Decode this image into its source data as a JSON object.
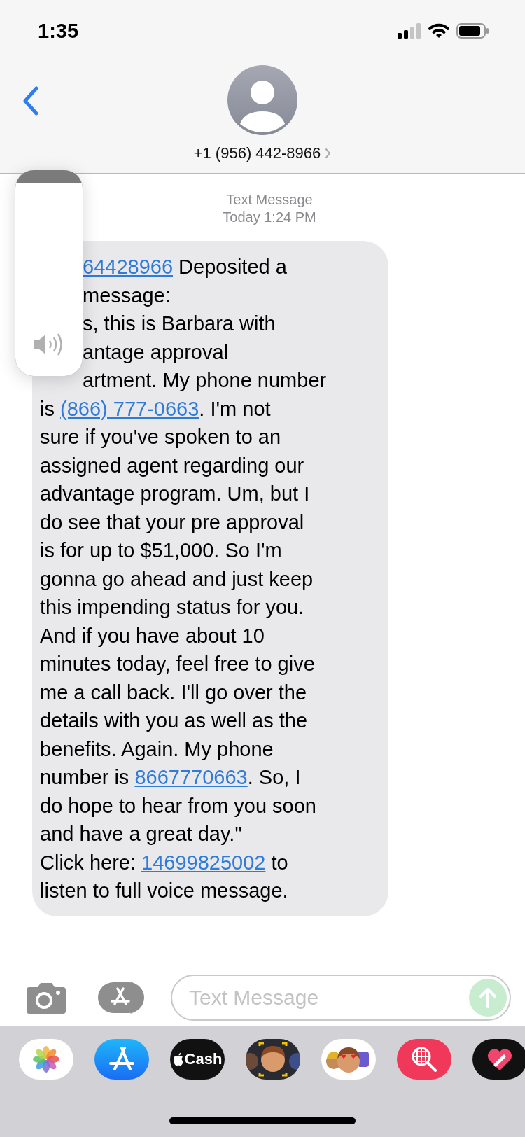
{
  "status_bar": {
    "time": "1:35"
  },
  "header": {
    "contact": "+1 (956) 442-8966"
  },
  "timestamp": {
    "service": "Text Message",
    "time": "Today 1:24 PM"
  },
  "message": {
    "lines": [
      {
        "covered": true,
        "parts": [
          {
            "kind": "link",
            "text": "64428966"
          },
          {
            "kind": "text",
            "text": " Deposited a"
          }
        ]
      },
      {
        "covered": true,
        "parts": [
          {
            "kind": "text",
            "text": "message:"
          }
        ]
      },
      {
        "covered": true,
        "parts": [
          {
            "kind": "text",
            "text": "s, this is Barbara with"
          }
        ]
      },
      {
        "covered": true,
        "parts": [
          {
            "kind": "text",
            "text": "antage approval"
          }
        ]
      },
      {
        "covered": true,
        "parts": [
          {
            "kind": "text",
            "text": "artment. My phone number"
          }
        ]
      },
      {
        "covered": false,
        "parts": [
          {
            "kind": "text",
            "text": "is "
          },
          {
            "kind": "link",
            "text": "(866) 777-0663"
          },
          {
            "kind": "text",
            "text": ". I'm not"
          }
        ]
      },
      {
        "covered": false,
        "parts": [
          {
            "kind": "text",
            "text": "sure if you've spoken to an"
          }
        ]
      },
      {
        "covered": false,
        "parts": [
          {
            "kind": "text",
            "text": "assigned agent regarding our"
          }
        ]
      },
      {
        "covered": false,
        "parts": [
          {
            "kind": "text",
            "text": "advantage program. Um, but I"
          }
        ]
      },
      {
        "covered": false,
        "parts": [
          {
            "kind": "text",
            "text": "do see that your pre approval"
          }
        ]
      },
      {
        "covered": false,
        "parts": [
          {
            "kind": "text",
            "text": "is for up to $51,000. So I'm"
          }
        ]
      },
      {
        "covered": false,
        "parts": [
          {
            "kind": "text",
            "text": "gonna go ahead and just keep"
          }
        ]
      },
      {
        "covered": false,
        "parts": [
          {
            "kind": "text",
            "text": "this impending status for you."
          }
        ]
      },
      {
        "covered": false,
        "parts": [
          {
            "kind": "text",
            "text": "And if you have about 10"
          }
        ]
      },
      {
        "covered": false,
        "parts": [
          {
            "kind": "text",
            "text": "minutes today, feel free to give"
          }
        ]
      },
      {
        "covered": false,
        "parts": [
          {
            "kind": "text",
            "text": "me a call back. I'll go over the"
          }
        ]
      },
      {
        "covered": false,
        "parts": [
          {
            "kind": "text",
            "text": "details with you as well as the"
          }
        ]
      },
      {
        "covered": false,
        "parts": [
          {
            "kind": "text",
            "text": "benefits. Again. My phone"
          }
        ]
      },
      {
        "covered": false,
        "parts": [
          {
            "kind": "text",
            "text": "number is "
          },
          {
            "kind": "link",
            "text": "8667770663"
          },
          {
            "kind": "text",
            "text": ". So, I"
          }
        ]
      },
      {
        "covered": false,
        "parts": [
          {
            "kind": "text",
            "text": "do hope to hear from you soon"
          }
        ]
      },
      {
        "covered": false,
        "parts": [
          {
            "kind": "text",
            "text": "and have a great day.\""
          }
        ]
      },
      {
        "covered": false,
        "parts": [
          {
            "kind": "text",
            "text": "Click here: "
          },
          {
            "kind": "link",
            "text": "14699825002"
          },
          {
            "kind": "text",
            "text": " to"
          }
        ]
      },
      {
        "covered": false,
        "parts": [
          {
            "kind": "text",
            "text": "listen to full voice message."
          }
        ]
      }
    ]
  },
  "volume_hud": {
    "level": 0.94
  },
  "compose": {
    "placeholder": "Text Message"
  },
  "app_drawer": [
    {
      "kind": "photos"
    },
    {
      "kind": "appstore"
    },
    {
      "kind": "cash",
      "label": "Cash"
    },
    {
      "kind": "memoji"
    },
    {
      "kind": "stickers"
    },
    {
      "kind": "search"
    },
    {
      "kind": "touch"
    }
  ]
}
